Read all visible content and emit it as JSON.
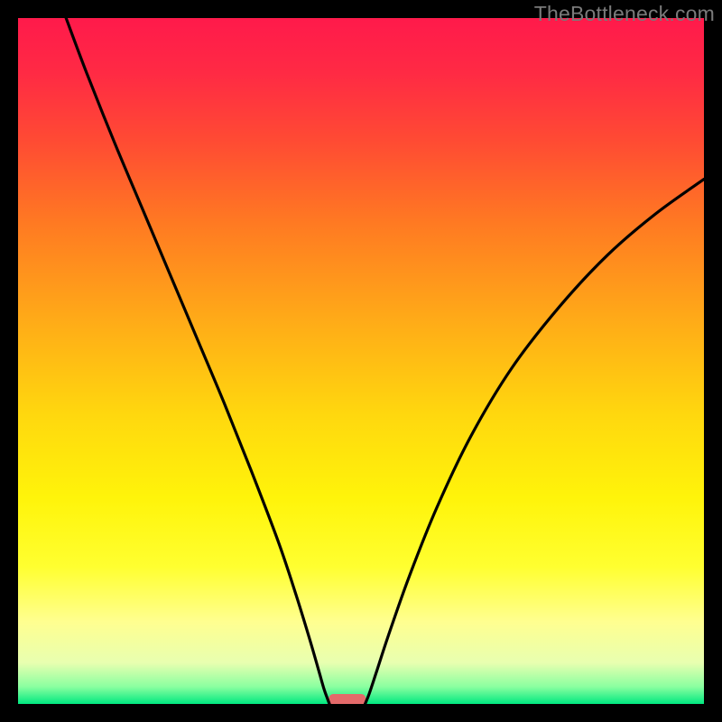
{
  "watermark": "TheBottleneck.com",
  "chart_data": {
    "type": "line",
    "title": "",
    "xlabel": "",
    "ylabel": "",
    "xlim": [
      0,
      100
    ],
    "ylim": [
      0,
      100
    ],
    "background_gradient": {
      "stops": [
        {
          "offset": 0.0,
          "color": "#ff1a4b"
        },
        {
          "offset": 0.08,
          "color": "#ff2a44"
        },
        {
          "offset": 0.18,
          "color": "#ff4b33"
        },
        {
          "offset": 0.3,
          "color": "#ff7a22"
        },
        {
          "offset": 0.45,
          "color": "#ffae17"
        },
        {
          "offset": 0.58,
          "color": "#ffd80e"
        },
        {
          "offset": 0.7,
          "color": "#fff40a"
        },
        {
          "offset": 0.8,
          "color": "#ffff30"
        },
        {
          "offset": 0.88,
          "color": "#ffff90"
        },
        {
          "offset": 0.94,
          "color": "#e8ffb0"
        },
        {
          "offset": 0.975,
          "color": "#8affa0"
        },
        {
          "offset": 1.0,
          "color": "#00e880"
        }
      ]
    },
    "series": [
      {
        "name": "left-curve",
        "x": [
          7.0,
          10.0,
          14.0,
          18.0,
          22.0,
          26.0,
          30.0,
          34.0,
          38.0,
          40.5,
          42.5,
          43.8,
          44.6,
          45.1,
          45.4
        ],
        "y": [
          100.0,
          92.0,
          82.0,
          72.5,
          63.0,
          53.5,
          44.0,
          34.0,
          23.5,
          16.0,
          9.5,
          5.0,
          2.2,
          0.8,
          0.0
        ]
      },
      {
        "name": "right-curve",
        "x": [
          50.6,
          51.2,
          52.2,
          54.0,
          57.0,
          61.0,
          66.0,
          72.0,
          79.0,
          86.0,
          93.0,
          100.0
        ],
        "y": [
          0.0,
          1.5,
          4.5,
          10.0,
          18.5,
          28.5,
          39.0,
          49.0,
          58.0,
          65.5,
          71.5,
          76.5
        ]
      }
    ],
    "marker": {
      "x_start": 45.3,
      "x_end": 50.7,
      "y": 0.0,
      "color": "#e46a6a"
    }
  }
}
